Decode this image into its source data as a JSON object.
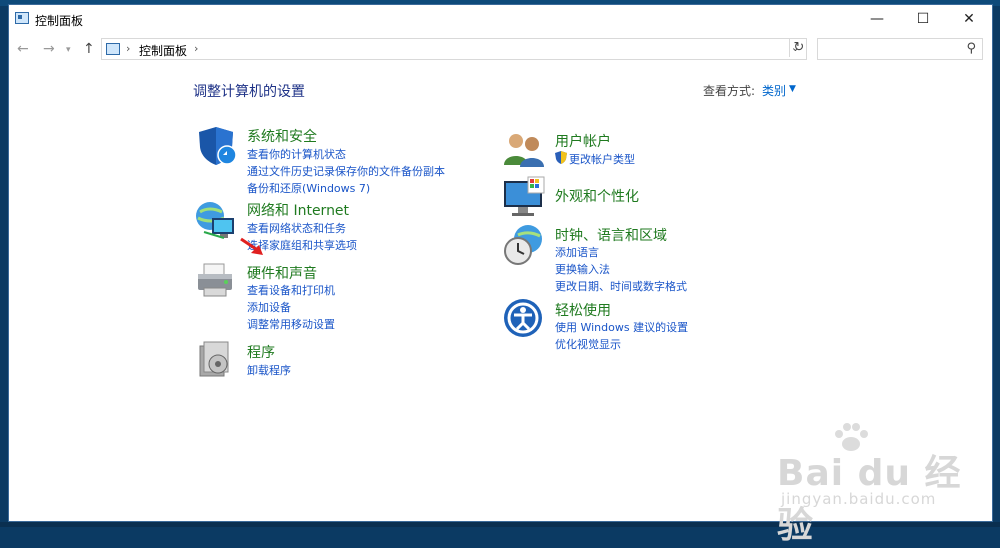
{
  "window": {
    "title": "控制面板",
    "controls": {
      "minimize": "—",
      "maximize": "☐",
      "close": "✕"
    }
  },
  "address": {
    "path": "控制面板",
    "separator": "›",
    "search_placeholder": ""
  },
  "content": {
    "heading": "调整计算机的设置",
    "view_by_label": "查看方式:",
    "view_by_value": "类别"
  },
  "categories": [
    {
      "id": "system-security",
      "icon": "shield-icon",
      "title": "系统和安全",
      "links": [
        "查看你的计算机状态",
        "通过文件历史记录保存你的文件备份副本",
        "备份和还原(Windows 7)"
      ]
    },
    {
      "id": "network-internet",
      "icon": "globe-network-icon",
      "title": "网络和 Internet",
      "links": [
        "查看网络状态和任务",
        "选择家庭组和共享选项"
      ]
    },
    {
      "id": "hardware-sound",
      "icon": "printer-icon",
      "title": "硬件和声音",
      "links": [
        "查看设备和打印机",
        "添加设备",
        "调整常用移动设置"
      ]
    },
    {
      "id": "programs",
      "icon": "programs-icon",
      "title": "程序",
      "links": [
        "卸载程序"
      ]
    },
    {
      "id": "user-accounts",
      "icon": "users-icon",
      "title": "用户帐户",
      "links": [
        "更改帐户类型"
      ]
    },
    {
      "id": "appearance",
      "icon": "display-icon",
      "title": "外观和个性化",
      "links": []
    },
    {
      "id": "clock-region",
      "icon": "clock-globe-icon",
      "title": "时钟、语言和区域",
      "links": [
        "添加语言",
        "更换输入法",
        "更改日期、时间或数字格式"
      ]
    },
    {
      "id": "ease-of-access",
      "icon": "ease-of-access-icon",
      "title": "轻松使用",
      "links": [
        "使用 Windows 建议的设置",
        "优化视觉显示"
      ]
    }
  ],
  "watermark": {
    "brand": "Bai du 经验",
    "site": "jingyan.baidu.com"
  },
  "colors": {
    "title_green": "#1f7a1f",
    "link_blue": "#1a55c8",
    "heading_blue": "#1e3287",
    "annotation_red": "#e02020"
  }
}
